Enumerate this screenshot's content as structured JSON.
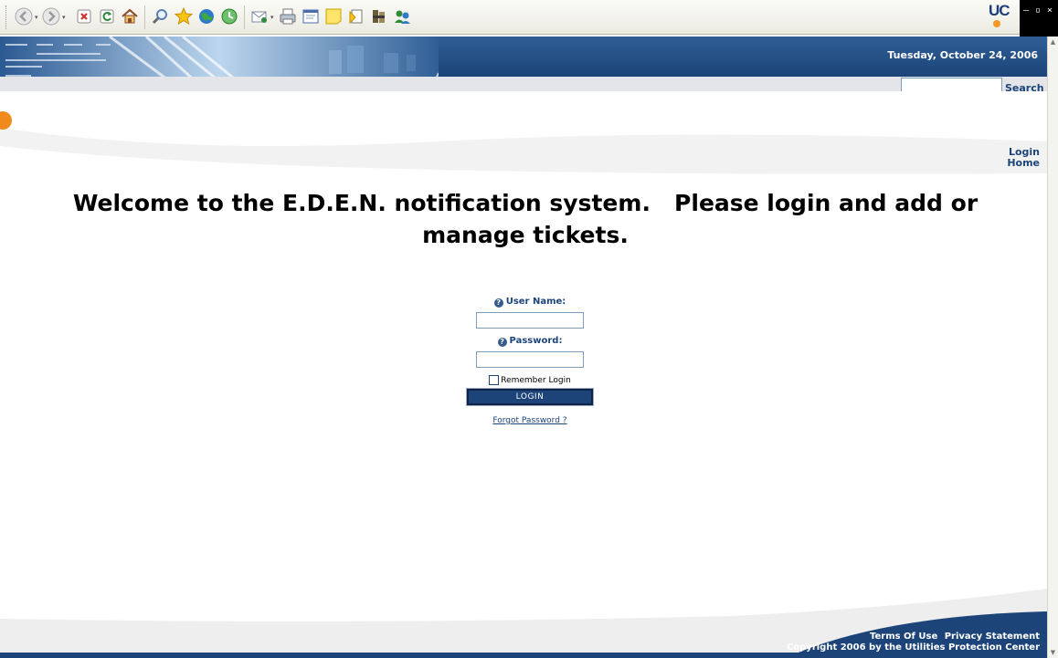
{
  "browser": {
    "toolbar_buttons": [
      "back-icon",
      "forward-icon",
      "stop-icon",
      "refresh-icon",
      "home-icon",
      "search-icon",
      "favorites-icon",
      "media-icon",
      "history-icon",
      "mail-icon",
      "print-icon",
      "edit-icon",
      "discuss-icon",
      "research-icon",
      "messenger-icon",
      "contacts-icon"
    ],
    "logo_text": "UC",
    "controls": [
      "–",
      "▫",
      "×"
    ]
  },
  "header": {
    "date": "Tuesday, October 24, 2006",
    "search_label": "Search",
    "search_value": ""
  },
  "nav": {
    "login": "Login",
    "home": "Home"
  },
  "welcome": {
    "line1": "Welcome to the E.D.E.N. notification system.   Please login and add or",
    "line2": "manage tickets."
  },
  "form": {
    "username_label": "User Name:",
    "username_value": "",
    "password_label": "Password:",
    "password_value": "",
    "remember_label": "Remember Login",
    "remember_checked": false,
    "login_button": "LOGIN",
    "forgot": "Forgot Password ?"
  },
  "footer": {
    "terms": "Terms Of Use",
    "privacy": "Privacy Statement",
    "copyright": "Copyright 2006 by the Utilities Protection Center"
  },
  "colors": {
    "brand_blue": "#1c4479",
    "accent_orange": "#f08a1c"
  }
}
